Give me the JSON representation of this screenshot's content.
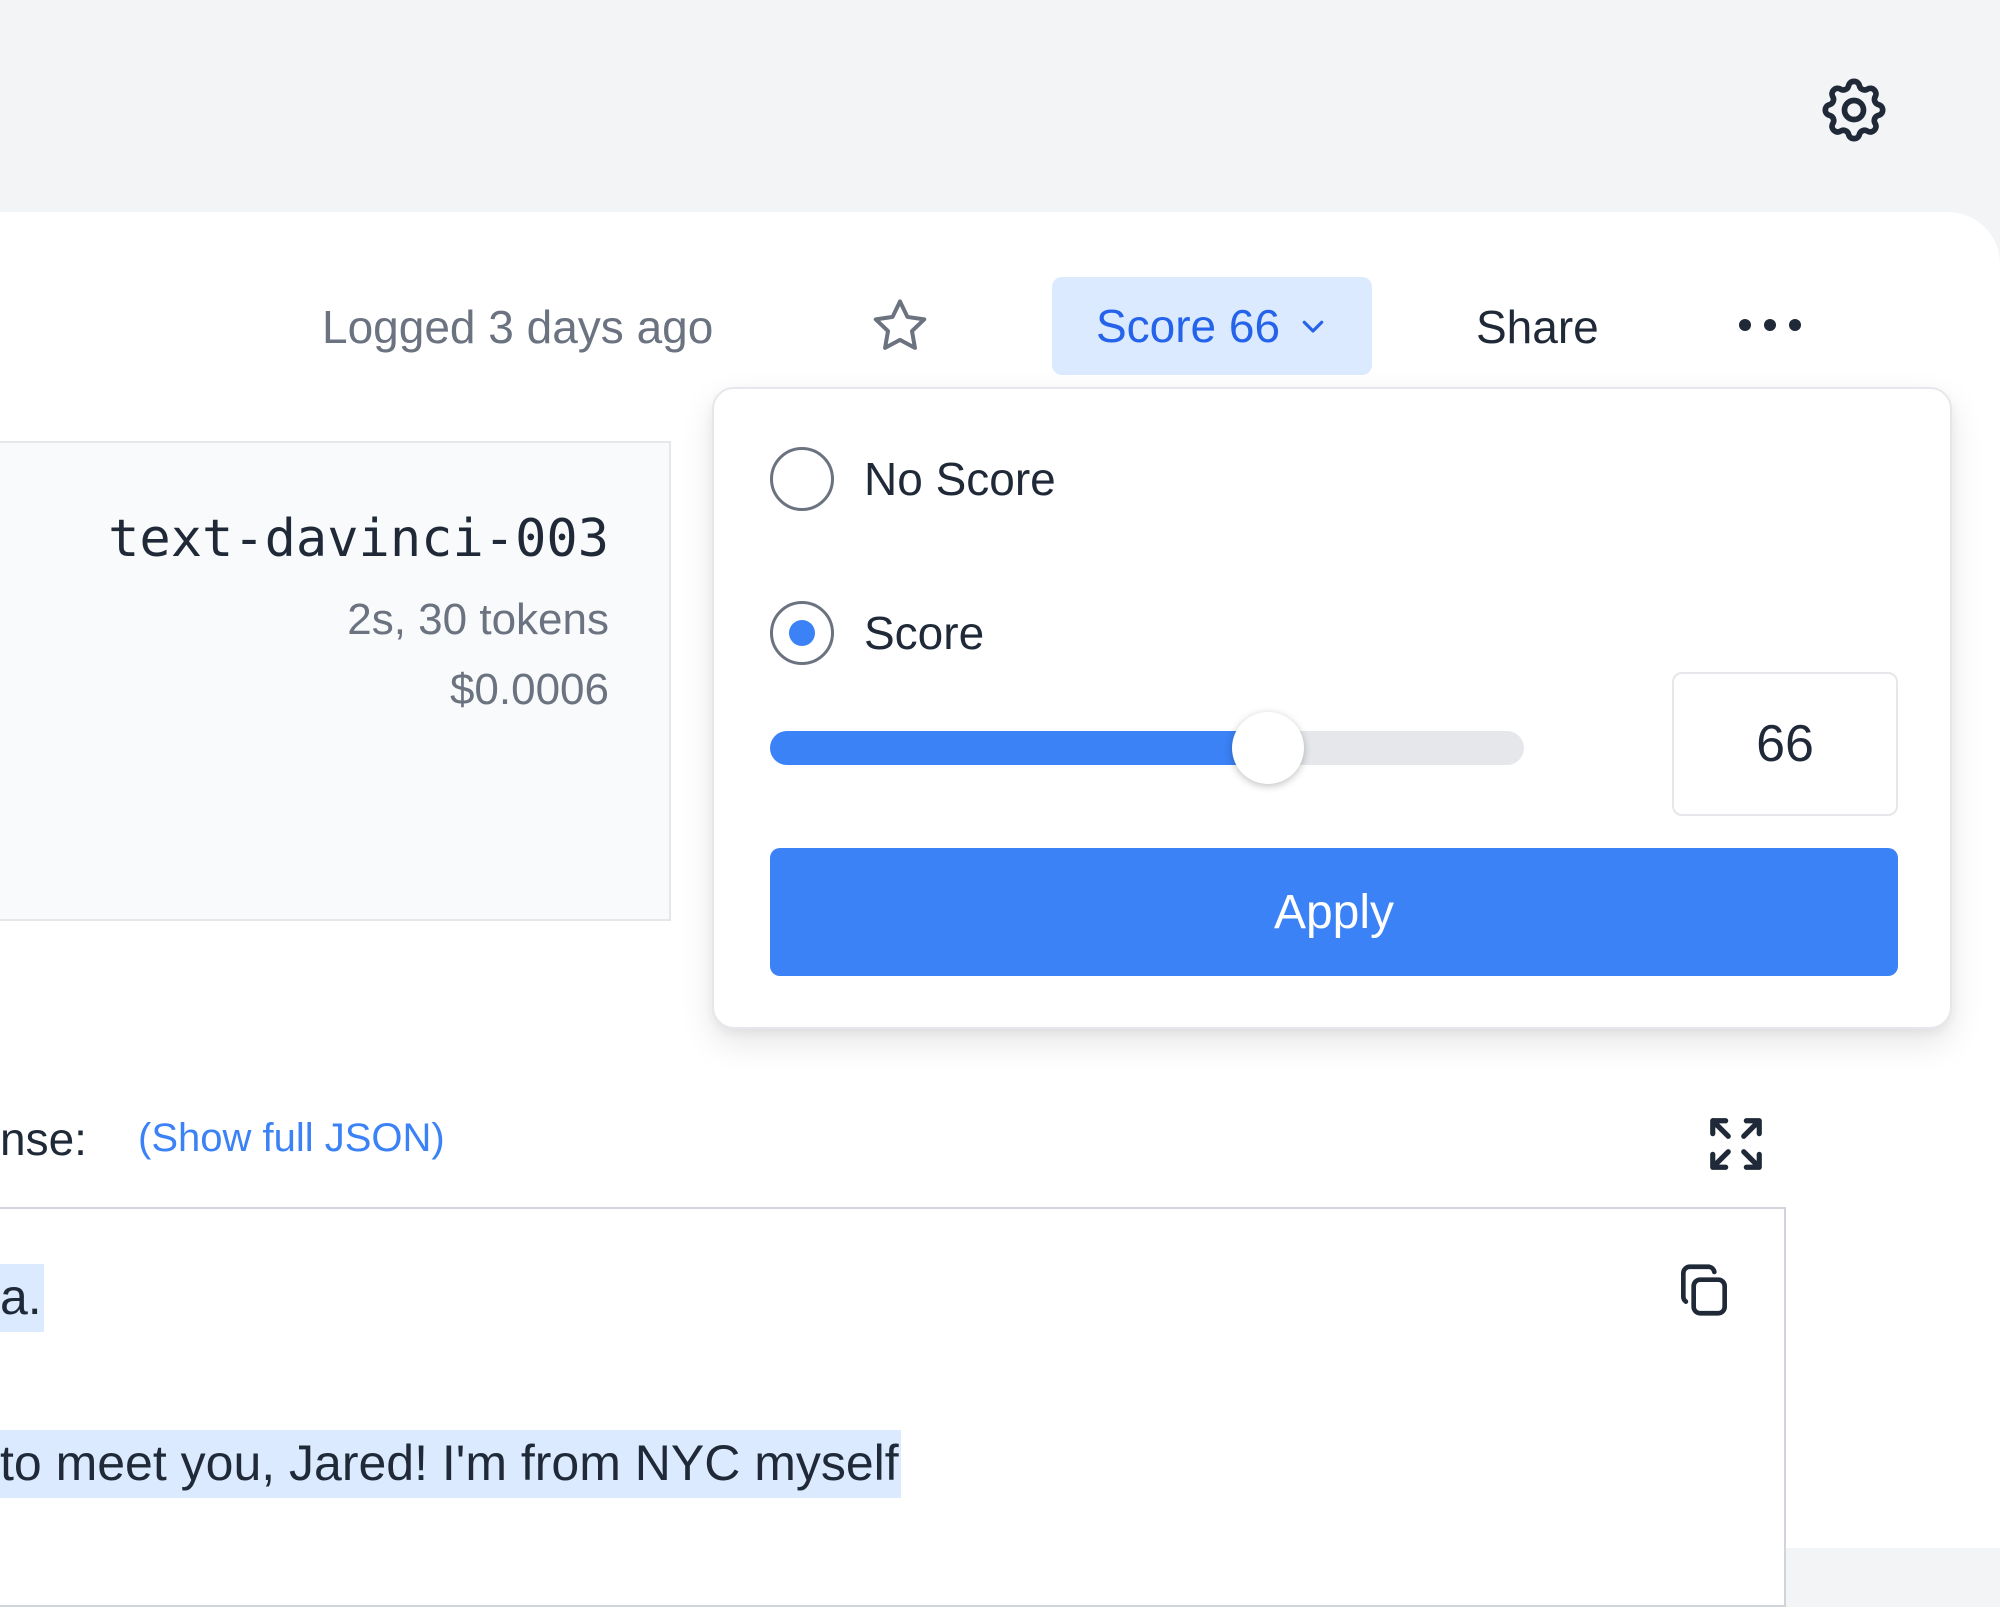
{
  "header": {
    "logged_text": "Logged 3 days ago",
    "score_button_label": "Score 66",
    "share_label": "Share"
  },
  "icons": {
    "settings": "gear-icon",
    "star": "star-icon",
    "chevron": "chevron-down-icon",
    "more": "more-horizontal-icon",
    "expand": "expand-icon",
    "copy": "copy-icon"
  },
  "model_info": {
    "name": "text-davinci-003",
    "meta": "2s, 30 tokens",
    "cost": "$0.0006"
  },
  "score_popover": {
    "options": [
      {
        "label": "No Score",
        "checked": false
      },
      {
        "label": "Score",
        "checked": true
      }
    ],
    "slider": {
      "value": 66,
      "min": 0,
      "max": 100
    },
    "input_value": "66",
    "apply_label": "Apply"
  },
  "response": {
    "label": "nse:",
    "show_json_label": "(Show full JSON)",
    "lines": [
      "a.",
      " to meet you, Jared! I'm from NYC myself"
    ]
  },
  "colors": {
    "accent": "#3b82f6",
    "accent_light": "#dbeafe",
    "background": "#f3f4f6",
    "highlight": "#dbeafe"
  }
}
